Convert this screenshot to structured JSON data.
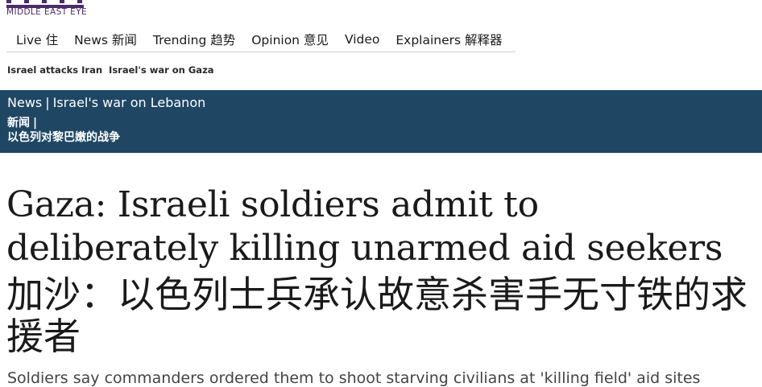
{
  "header": {
    "brand": "MIDDLE EAST EYE"
  },
  "nav": {
    "items": [
      {
        "label": "Live 住",
        "name": "nav-live"
      },
      {
        "label": "News 新闻",
        "name": "nav-news"
      },
      {
        "label": "Trending 趋势",
        "name": "nav-trending"
      },
      {
        "label": "Opinion 意见",
        "name": "nav-opinion"
      },
      {
        "label": "Video",
        "name": "nav-video"
      },
      {
        "label": "Explainers 解释器",
        "name": "nav-explainers"
      }
    ]
  },
  "topics": [
    "Israel attacks Iran",
    "Israel's war on Gaza"
  ],
  "category_band": {
    "section": "News",
    "separator": "|",
    "topic": "Israel's war on Lebanon",
    "section_zh": "新闻",
    "topic_zh": "以色列对黎巴嫩的战争"
  },
  "article": {
    "headline_en": "Gaza: Israeli soldiers admit to deliberately killing unarmed aid seekers",
    "headline_zh": "加沙：以色列士兵承认故意杀害手无寸铁的求援者",
    "subheading": "Soldiers say commanders ordered them to shoot starving civilians at 'killing field' aid sites"
  },
  "colors": {
    "band_bg": "#1f4764",
    "brand": "#4a2c6b",
    "live_dot": "#c0392b"
  }
}
